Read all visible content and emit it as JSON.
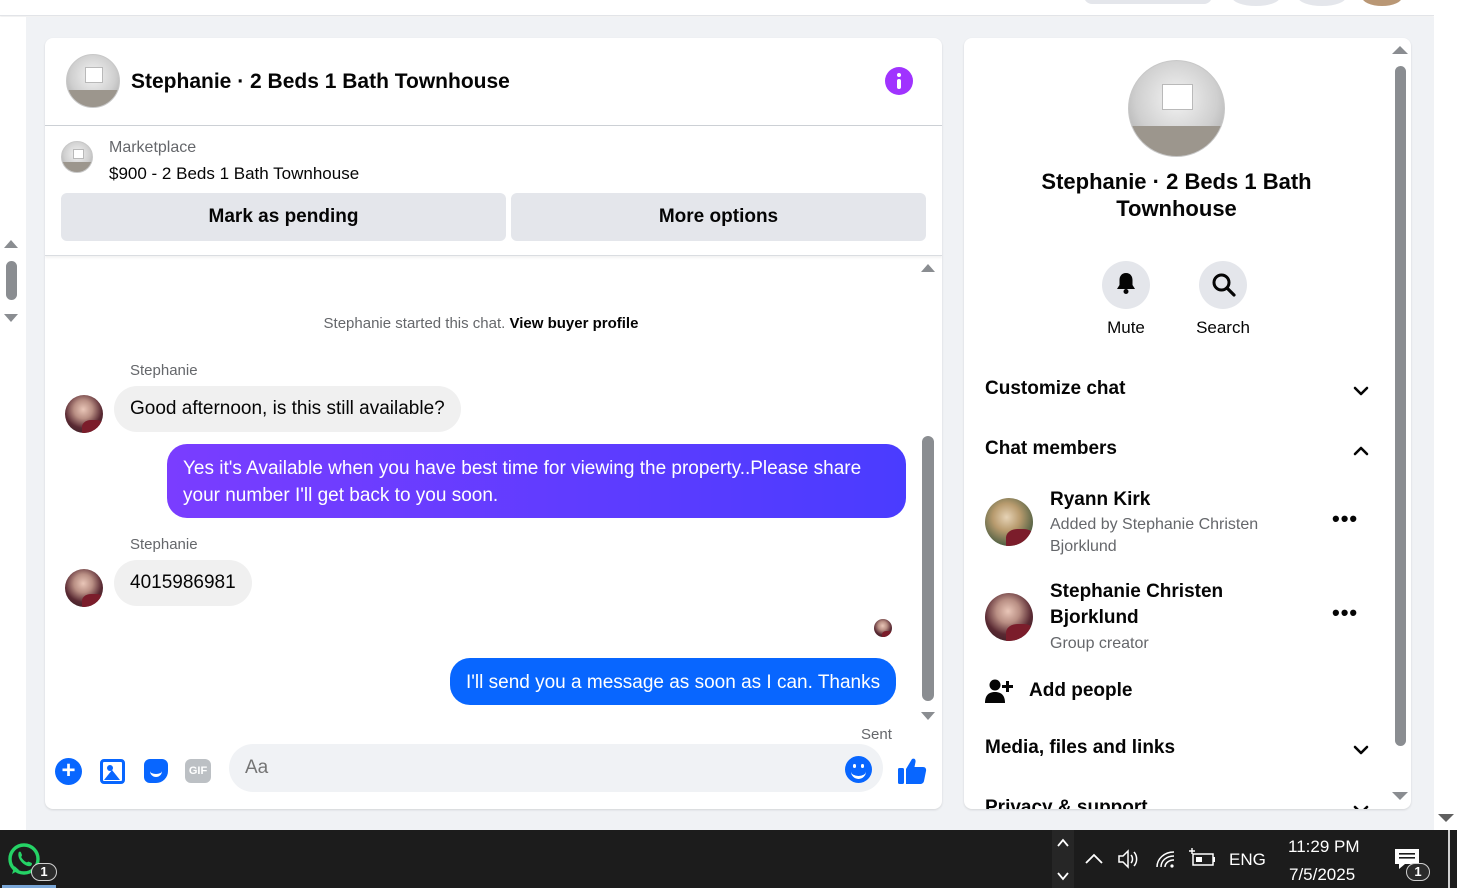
{
  "chat": {
    "title": "Stephanie · 2 Beds 1 Bath Townhouse",
    "marketplace_label": "Marketplace",
    "listing": "$900 - 2 Beds 1 Bath Townhouse",
    "mark_pending_label": "Mark as pending",
    "more_options_label": "More options",
    "system_text": "Stephanie started this chat.",
    "system_link": "View buyer profile",
    "messages": [
      {
        "sender": "Stephanie",
        "text": "Good afternoon, is this still available?",
        "direction": "in"
      },
      {
        "text": "Yes it's Available when you have best time for viewing the property..Please share your number I'll get back to you soon.",
        "direction": "out"
      },
      {
        "sender": "Stephanie",
        "text": "4015986981",
        "direction": "in"
      },
      {
        "text": "I'll send you a message as soon as I can. Thanks",
        "direction": "out"
      }
    ],
    "sent_status": "Sent",
    "composer_placeholder": "Aa",
    "gif_label": "GIF"
  },
  "info_panel": {
    "title": "Stephanie · 2 Beds 1 Bath Townhouse",
    "mute_label": "Mute",
    "search_label": "Search",
    "customize_label": "Customize chat",
    "members_label": "Chat members",
    "members": [
      {
        "name": "Ryann Kirk",
        "sub": "Added by Stephanie Christen Bjorklund"
      },
      {
        "name": "Stephanie Christen Bjorklund",
        "sub": "Group creator"
      }
    ],
    "add_people_label": "Add people",
    "media_label": "Media, files and links",
    "privacy_label": "Privacy & support"
  },
  "taskbar": {
    "whatsapp_badge": "1",
    "language": "ENG",
    "time": "11:29 PM",
    "date": "7/5/2025",
    "notification_badge": "1"
  },
  "colors": {
    "accent_blue": "#0866ff",
    "accent_purple": "#a033ff",
    "bubble_out_purple_start": "#7a3dff",
    "bubble_out_purple_end": "#4a3cff",
    "bubble_in": "#f0f0f0",
    "taskbar": "#1c1c1c"
  }
}
